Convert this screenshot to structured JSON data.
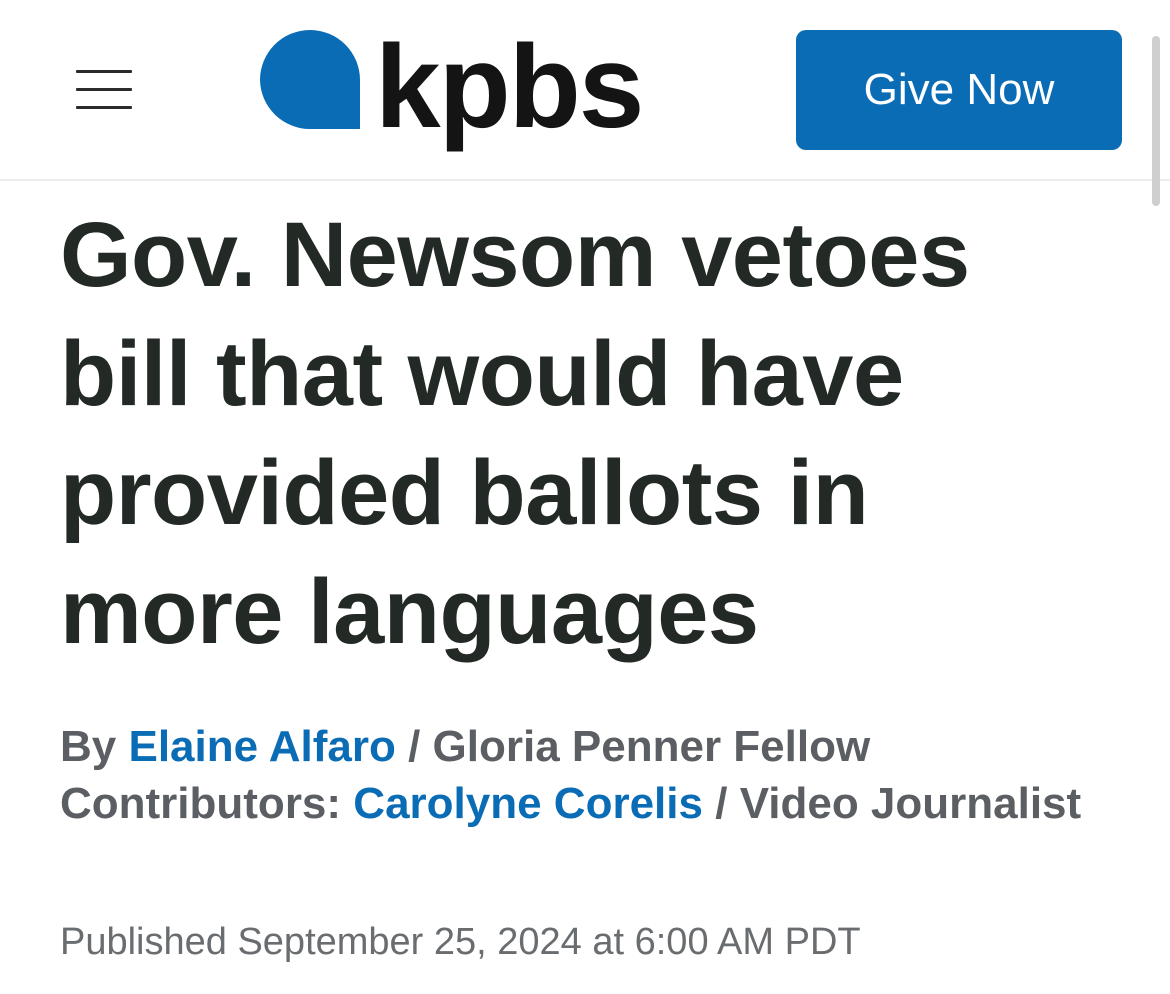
{
  "header": {
    "logo_text": "kpbs",
    "give_button_label": "Give Now",
    "brand_color": "#0b6cb6",
    "menu_icon": "hamburger-menu-icon"
  },
  "article": {
    "headline_lines": [
      "Gov. Newsom vetoes",
      "bill that would have",
      "provided ballots in",
      "more languages"
    ],
    "byline": {
      "by_label": "By",
      "author_name": "Elaine Alfaro",
      "author_separator": "/",
      "author_title": "Gloria Penner Fellow",
      "contributors_label": "Contributors:",
      "contributor_name": "Carolyne Corelis",
      "contributor_separator": "/",
      "contributor_title": "Video Journalist"
    },
    "published": "Published September 25, 2024 at 6:00 AM PDT"
  }
}
